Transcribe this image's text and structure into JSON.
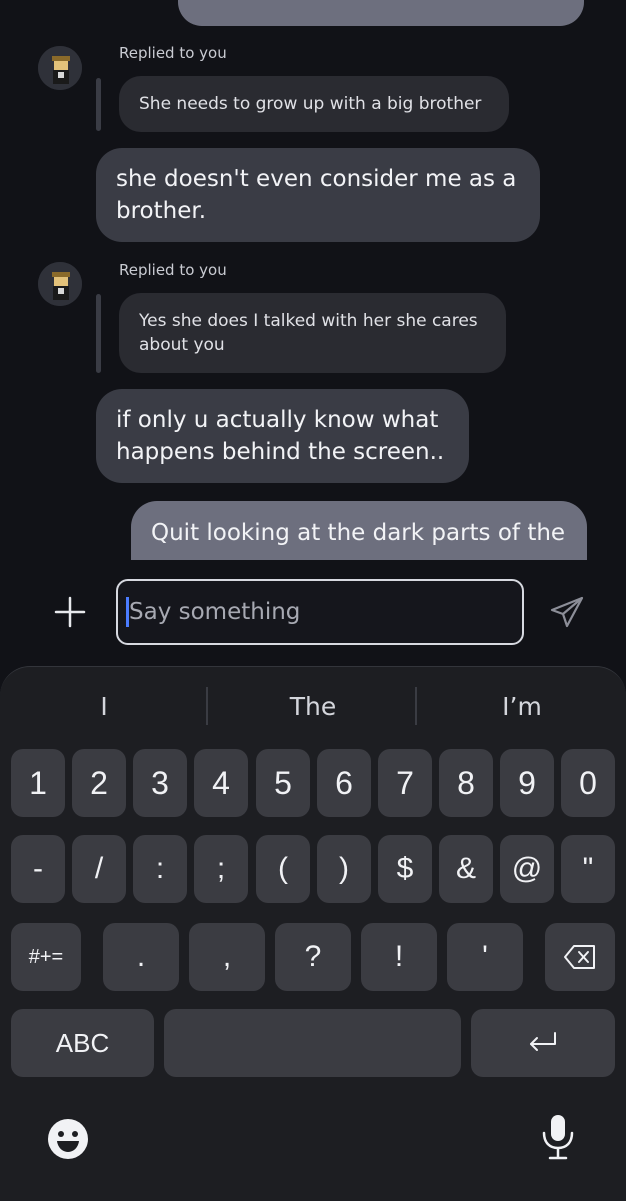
{
  "conversation": {
    "messages": [
      {
        "replied_label": "Replied to you",
        "quoted_text": "She needs to grow up with a big brother",
        "reply_text": "she doesn't even consider me as a brother."
      },
      {
        "replied_label": "Replied to you",
        "quoted_text": "Yes she does I talked with her she cares about you",
        "reply_text": "if only u actually know what happens behind the screen.."
      }
    ],
    "my_message": "Quit looking at the dark parts of the"
  },
  "composer": {
    "placeholder": "Say something"
  },
  "keyboard": {
    "suggestions": [
      "I",
      "The",
      "I’m"
    ],
    "row1": [
      "1",
      "2",
      "3",
      "4",
      "5",
      "6",
      "7",
      "8",
      "9",
      "0"
    ],
    "row2": [
      "-",
      "/",
      ":",
      ";",
      "(",
      ")",
      "$",
      "&",
      "@",
      "\""
    ],
    "row3": [
      "#+=",
      ".",
      ",",
      "?",
      "!",
      "'"
    ],
    "abc_label": "ABC"
  }
}
